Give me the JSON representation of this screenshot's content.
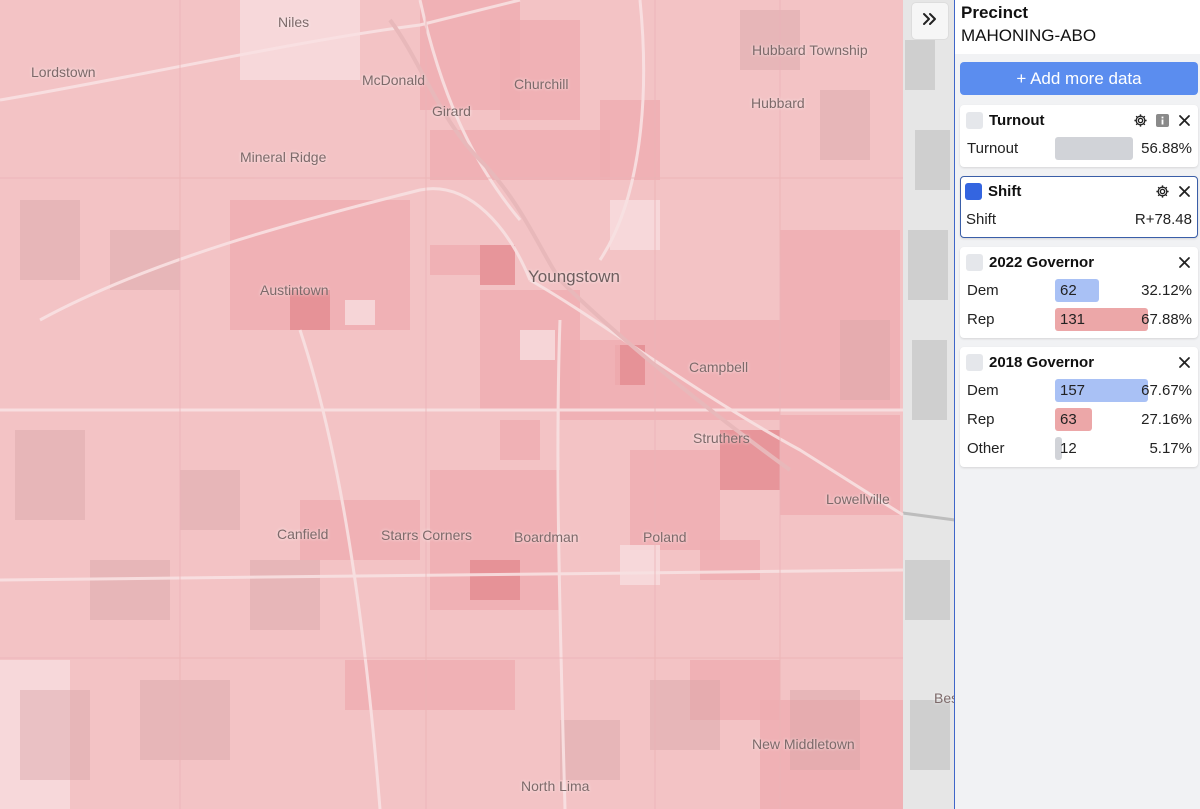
{
  "map": {
    "towns": [
      {
        "name": "Niles",
        "big": false
      },
      {
        "name": "Lordstown",
        "big": false
      },
      {
        "name": "McDonald",
        "big": false
      },
      {
        "name": "Churchill",
        "big": false
      },
      {
        "name": "Hubbard Township",
        "big": false
      },
      {
        "name": "Hubbard",
        "big": false
      },
      {
        "name": "Girard",
        "big": false
      },
      {
        "name": "Mineral Ridge",
        "big": false
      },
      {
        "name": "Youngstown",
        "big": true
      },
      {
        "name": "Austintown",
        "big": false
      },
      {
        "name": "Campbell",
        "big": false
      },
      {
        "name": "Struthers",
        "big": false
      },
      {
        "name": "Lowellville",
        "big": false
      },
      {
        "name": "Canfield",
        "big": false
      },
      {
        "name": "Starrs Corners",
        "big": false
      },
      {
        "name": "Boardman",
        "big": false
      },
      {
        "name": "Poland",
        "big": false
      },
      {
        "name": "Bes",
        "big": false
      },
      {
        "name": "New Middletown",
        "big": false
      },
      {
        "name": "North Lima",
        "big": false
      }
    ],
    "colors": {
      "base": "#f4c4c6",
      "mid": "#eeaeb1",
      "dark": "#e48d92",
      "light": "#f7dcdd"
    }
  },
  "sidebar": {
    "title": "Precinct",
    "subtitle": "MAHONING-ABO",
    "add_button": "+ Add more data",
    "cards": [
      {
        "title": "Turnout",
        "checked": false,
        "selected": false,
        "icons": [
          "gear-icon",
          "info-icon",
          "close-icon"
        ],
        "rows": [
          {
            "label": "Turnout",
            "bar_fraction": 0.5688,
            "bar_color": "#d1d3d8",
            "count": "",
            "value": "56.88%"
          }
        ]
      },
      {
        "title": "Shift",
        "checked": true,
        "selected": true,
        "icons": [
          "gear-icon",
          "close-icon"
        ],
        "rows": [
          {
            "label": "Shift",
            "value": "R+78.48"
          }
        ]
      },
      {
        "title": "2022 Governor",
        "checked": false,
        "selected": false,
        "icons": [
          "close-icon"
        ],
        "rows": [
          {
            "label": "Dem",
            "bar_fraction": 0.3212,
            "bar_color": "#a9c1f5",
            "count": "62",
            "value": "32.12%"
          },
          {
            "label": "Rep",
            "bar_fraction": 0.6788,
            "bar_color": "#eca7a8",
            "count": "131",
            "value": "67.88%"
          }
        ]
      },
      {
        "title": "2018 Governor",
        "checked": false,
        "selected": false,
        "icons": [
          "close-icon"
        ],
        "rows": [
          {
            "label": "Dem",
            "bar_fraction": 0.6767,
            "bar_color": "#a9c1f5",
            "count": "157",
            "value": "67.67%"
          },
          {
            "label": "Rep",
            "bar_fraction": 0.2716,
            "bar_color": "#eca7a8",
            "count": "63",
            "value": "27.16%"
          },
          {
            "label": "Other",
            "bar_fraction": 0.0517,
            "bar_color": "#d1d3d8",
            "count": "12",
            "value": "5.17%"
          }
        ]
      }
    ]
  }
}
